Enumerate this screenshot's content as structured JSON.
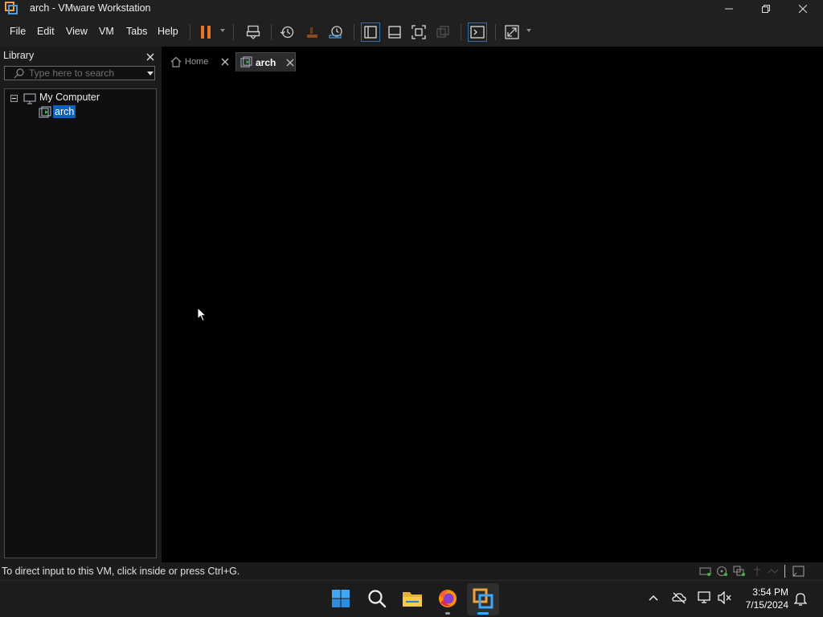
{
  "window": {
    "title": "arch - VMware Workstation"
  },
  "menu": {
    "items": [
      "File",
      "Edit",
      "View",
      "VM",
      "Tabs",
      "Help"
    ]
  },
  "toolbar": {
    "icons": [
      "pause-icon",
      "send-ctrl-alt-del-icon",
      "snapshot-icon",
      "revert-snapshot-icon",
      "snapshot-manager-icon",
      "show-library-icon",
      "thumbnail-bar-icon",
      "full-screen-icon",
      "unity-icon",
      "console-view-icon",
      "stretch-guest-icon"
    ],
    "accent_color": "#e8742c"
  },
  "library": {
    "title": "Library",
    "search_placeholder": "Type here to search",
    "tree": {
      "root_label": "My Computer",
      "children": [
        {
          "label": "arch",
          "selected": true
        }
      ]
    },
    "selection_color": "#0b63c4"
  },
  "tabs": [
    {
      "label": "Home",
      "active": false
    },
    {
      "label": "arch",
      "active": true
    }
  ],
  "status": {
    "message": "To direct input to this VM, click inside or press Ctrl+G."
  },
  "taskbar": {
    "apps": [
      "windows-start-icon",
      "search-icon",
      "file-explorer-icon",
      "firefox-icon",
      "vmware-icon"
    ],
    "time": "3:54 PM",
    "date": "7/15/2024"
  }
}
